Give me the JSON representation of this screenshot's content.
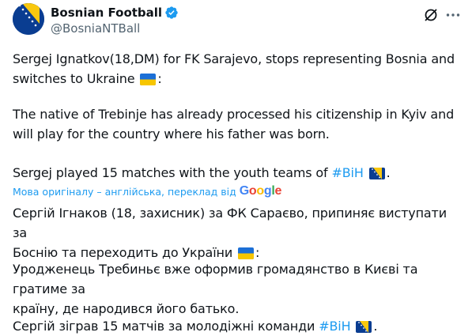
{
  "author": {
    "display_name": "Bosnian Football",
    "handle": "@BosniaNTBall",
    "verified": true,
    "avatar_icon": "bosnia-flag-avatar"
  },
  "actions": {
    "grok_icon": "grok-icon",
    "more_icon": "more-icon"
  },
  "original": {
    "p1_a": "Sergej Ignatkov(18,DM) for FK Sarajevo, stops representing Bosnia and",
    "p1_b": "switches to Ukraine",
    "p1_end": ":",
    "p2_a": "The native of Trebinje has already processed his citizenship in Kyiv and",
    "p2_b": "will play for the country where his father was born.",
    "p3_pre": "Sergej played 15 matches with the youth teams of ",
    "p3_tag": "#BiH",
    "p3_end": "."
  },
  "translation_note": {
    "label": "Мова оригіналу – англійська, переклад від",
    "provider_g1": "G",
    "provider_o1": "o",
    "provider_o2": "o",
    "provider_g2": "g",
    "provider_l": "l",
    "provider_e": "e"
  },
  "translated": {
    "p1_a": "Сергій Ігнаков (18, захисник) за ФК Сараєво, припиняє виступати за",
    "p1_b": "Боснію та переходить до України",
    "p1_end": ":",
    "p2_a": "Уродженець Требиньє вже оформив громадянство в Києві та гратиме за",
    "p2_b": "країну, де народився його батько.",
    "p3_pre": "Сергій зіграв 15 матчів за молодіжні команди ",
    "p3_tag": "#BiH",
    "p3_end": "."
  },
  "colors": {
    "text": "#0f1419",
    "secondary": "#536471",
    "link": "#1d9bf0",
    "verified": "#1d9bf0"
  }
}
